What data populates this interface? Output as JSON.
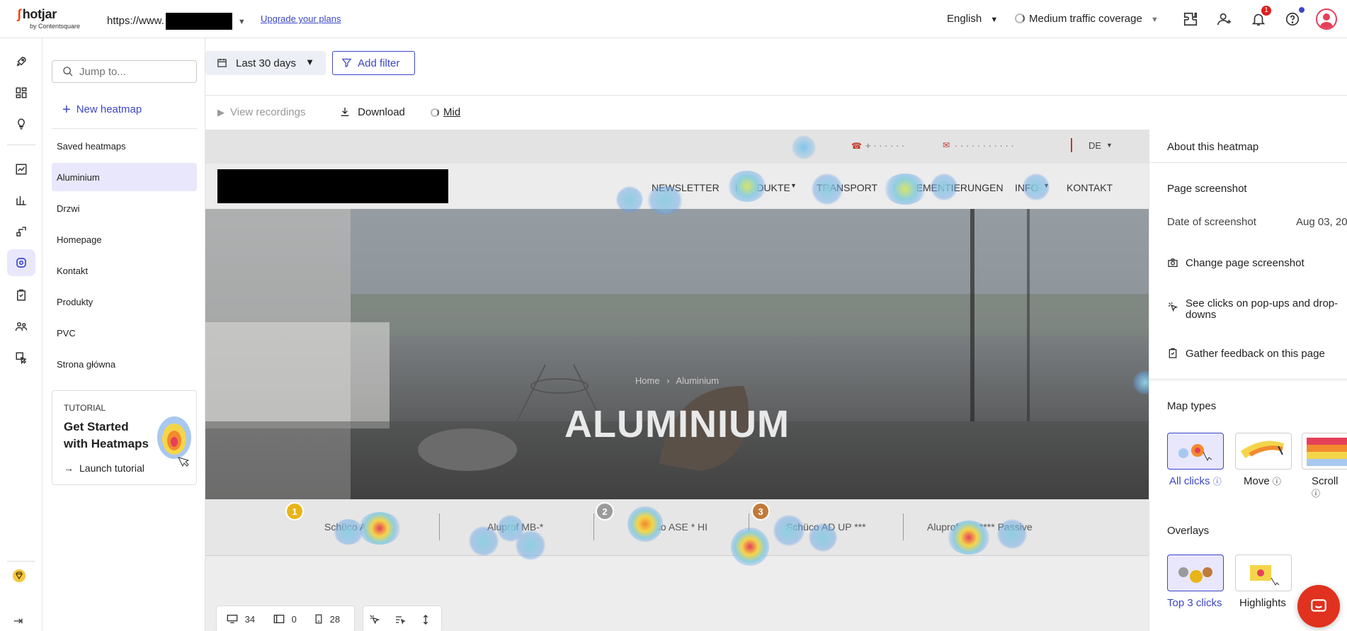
{
  "app": {
    "logo": "hotjar",
    "logo_sub": "by Contentsquare",
    "url_prefix": "https://www.",
    "upgrade_link": "Upgrade your plans",
    "language": "English",
    "traffic": "Medium traffic coverage",
    "notification_count": "1"
  },
  "sidebar": {
    "search_placeholder": "Jump to...",
    "new_heatmap": "New heatmap",
    "saved_title": "Saved heatmaps",
    "items": [
      "Aluminium",
      "Drzwi",
      "Homepage",
      "Kontakt",
      "Produkty",
      "PVC",
      "Strona główna"
    ],
    "selected": "Aluminium",
    "tutorial": {
      "label": "TUTORIAL",
      "title": "Get Started with Heatmaps",
      "launch": "Launch tutorial"
    }
  },
  "filters": {
    "date_range": "Last 30 days",
    "add_filter": "Add filter"
  },
  "actions": {
    "view_recordings": "View recordings",
    "download": "Download",
    "traffic_level": "Mid"
  },
  "site": {
    "phone": "+ · · · · · ·",
    "email": "· · · · · · · · · · ·",
    "lang": "DE",
    "nav": [
      "NEWSLETTER",
      "PRODUKTE",
      "TRANSPORT",
      "IMPLEMENTIERUNGEN",
      "INFO",
      "KONTAKT"
    ],
    "breadcrumb_home": "Home",
    "breadcrumb_sep": "›",
    "breadcrumb_current": "Aluminium",
    "hero_title": "ALUMINIUM",
    "tabs": [
      "Schüco AWS **",
      "Aluprof MB-*",
      "Schüco ASE * HI",
      "Schüco AD UP ***",
      "Aluprof MB-**** Passive"
    ],
    "ranks": [
      "1",
      "2",
      "3"
    ]
  },
  "device_counts": {
    "desktop": "34",
    "tablet": "0",
    "mobile": "28"
  },
  "panel": {
    "about_title": "About this heatmap",
    "page_screenshot": "Page screenshot",
    "date_label": "Date of screenshot",
    "date_value": "Aug 03, 20",
    "change_screenshot": "Change page screenshot",
    "popups": "See clicks on pop-ups and drop-downs",
    "feedback": "Gather feedback on this page",
    "map_types_title": "Map types",
    "map_types": [
      "All clicks",
      "Move",
      "Scroll"
    ],
    "overlays_title": "Overlays",
    "overlays": [
      "Top 3 clicks",
      "Highlights"
    ]
  },
  "colors": {
    "accent": "#3c46c8",
    "brand": "#ff3c00",
    "selected_bg": "#e8e7fb"
  }
}
